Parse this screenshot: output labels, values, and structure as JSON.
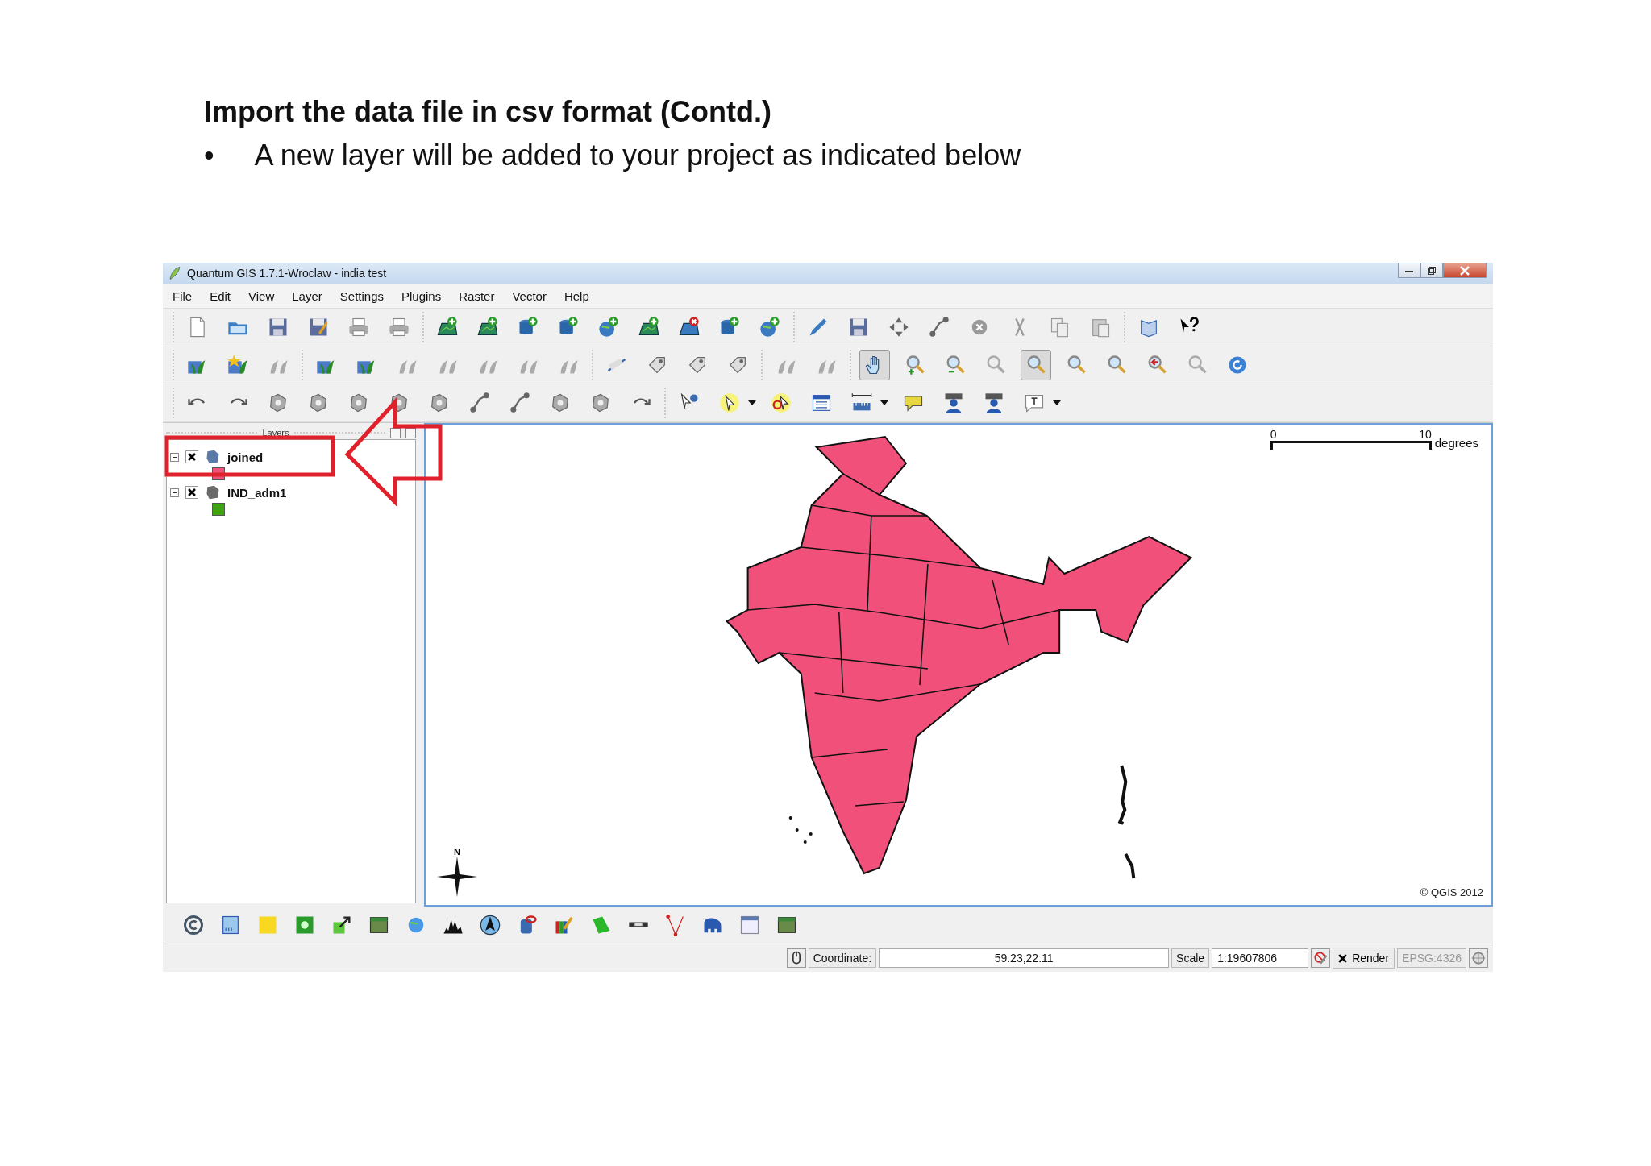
{
  "page": {
    "heading": "Import the data file in csv format (Contd.)",
    "bullet": "•",
    "text": "A new layer will be added to your project as indicated below"
  },
  "window": {
    "title": "Quantum GIS 1.7.1-Wroclaw - india test"
  },
  "menu": [
    "File",
    "Edit",
    "View",
    "Layer",
    "Settings",
    "Plugins",
    "Raster",
    "Vector",
    "Help"
  ],
  "map_navigation": [
    {
      "selected": true
    },
    {
      "selected": false
    },
    {
      "selected": false
    },
    {
      "selected": false
    },
    {
      "selected": true
    },
    {
      "selected": false
    },
    {
      "selected": false
    },
    {
      "selected": false
    },
    {
      "selected": false
    },
    {
      "selected": false
    }
  ],
  "layers_panel": {
    "title": "Layers",
    "layers": [
      {
        "name": "joined",
        "checked": true,
        "expanded": true,
        "color": "#f0507a"
      },
      {
        "name": "IND_adm1",
        "checked": true,
        "expanded": true,
        "color": "#3fa412"
      }
    ]
  },
  "map": {
    "scale_bar": {
      "start": "0",
      "end": "10",
      "unit": "degrees"
    },
    "north_label": "N",
    "copyright": "© QGIS 2012"
  },
  "status_bar": {
    "coordinate_label": "Coordinate:",
    "coordinate": "59.23,22.11",
    "scale_label": "Scale",
    "scale": "1:19607806",
    "render": {
      "label": "Render",
      "checked": true
    },
    "crs": "EPSG:4326"
  }
}
